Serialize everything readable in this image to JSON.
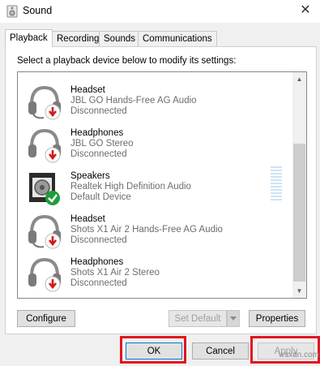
{
  "window": {
    "title": "Sound",
    "close_glyph": "✕"
  },
  "tabs": [
    {
      "label": "Playback",
      "active": true
    },
    {
      "label": "Recording",
      "active": false
    },
    {
      "label": "Sounds",
      "active": false
    },
    {
      "label": "Communications",
      "active": false
    }
  ],
  "instructions": "Select a playback device below to modify its settings:",
  "devices": [
    {
      "name": "Headset",
      "description": "JBL GO Hands-Free AG Audio",
      "status": "Disconnected",
      "icon": "headset-disconnected-icon"
    },
    {
      "name": "Headphones",
      "description": "JBL GO Stereo",
      "status": "Disconnected",
      "icon": "headphones-disconnected-icon"
    },
    {
      "name": "Speakers",
      "description": "Realtek High Definition Audio",
      "status": "Default Device",
      "icon": "speakers-default-icon"
    },
    {
      "name": "Headset",
      "description": "Shots X1 Air 2 Hands-Free AG Audio",
      "status": "Disconnected",
      "icon": "headset-disconnected-icon"
    },
    {
      "name": "Headphones",
      "description": "Shots X1 Air 2 Stereo",
      "status": "Disconnected",
      "icon": "headphones-disconnected-icon"
    }
  ],
  "buttons": {
    "configure": "Configure",
    "set_default": "Set Default",
    "properties": "Properties",
    "ok": "OK",
    "cancel": "Cancel",
    "apply": "Apply"
  },
  "watermark": "wsxdn.com",
  "colors": {
    "highlight": "#e3141f",
    "status_ok": "#1e9e3a",
    "status_disconnected": "#d11a1a"
  }
}
